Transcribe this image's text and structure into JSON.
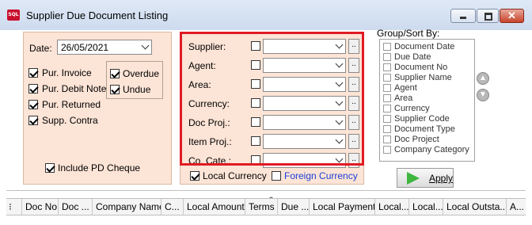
{
  "window": {
    "app_icon": "SQL",
    "title": "Supplier Due Document Listing",
    "minimize_icon": "minimize-icon",
    "maximize_icon": "maximize-icon",
    "close_icon": "close-icon",
    "close_glyph": "✕"
  },
  "filters_left": {
    "date_label": "Date:",
    "date_value": "26/05/2021",
    "doc_types": [
      {
        "label": "Pur. Invoice",
        "checked": true
      },
      {
        "label": "Pur. Debit Note",
        "checked": true
      },
      {
        "label": "Pur. Returned",
        "checked": true
      },
      {
        "label": "Supp. Contra",
        "checked": true
      }
    ],
    "overdue_label": "Overdue",
    "undue_label": "Undue",
    "include_pd_label": "Include PD Cheque"
  },
  "filters_mid": {
    "fields": [
      {
        "label": "Supplier:",
        "value": ""
      },
      {
        "label": "Agent:",
        "value": ""
      },
      {
        "label": "Area:",
        "value": ""
      },
      {
        "label": "Currency:",
        "value": ""
      },
      {
        "label": "Doc Proj.:",
        "value": ""
      },
      {
        "label": "Item Proj.:",
        "value": ""
      },
      {
        "label": "Co. Cate.:",
        "value": ""
      }
    ],
    "ellipsis": "..",
    "local_currency_label": "Local Currency",
    "foreign_currency_label": "Foreign Currency"
  },
  "group_sort": {
    "title": "Group/Sort By:",
    "items": [
      "Document Date",
      "Due Date",
      "Document No",
      "Supplier Name",
      "Agent",
      "Area",
      "Currency",
      "Supplier Code",
      "Document Type",
      "Doc Project",
      "Company Category"
    ],
    "up_glyph": "▲",
    "down_glyph": "▼"
  },
  "apply_label": "Apply",
  "splitter_glyph": "︿",
  "grid": {
    "row_icon": "⁝",
    "columns": [
      "Doc No",
      "Doc ...",
      "Company Name",
      "C...",
      "Local Amount",
      "Terms",
      "Due ...",
      "Local Payment",
      "Local...",
      "Local...",
      "Local Outsta...",
      "A..."
    ]
  }
}
